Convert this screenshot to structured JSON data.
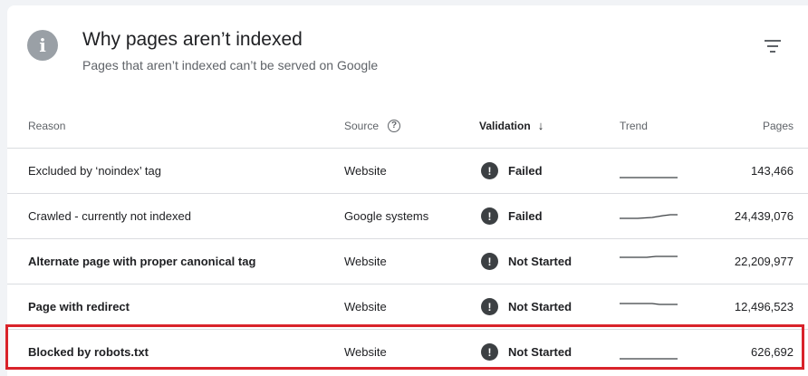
{
  "header": {
    "title": "Why pages aren’t indexed",
    "subtitle": "Pages that aren’t indexed can’t be served on Google"
  },
  "columns": {
    "reason": "Reason",
    "source": "Source",
    "validation": "Validation",
    "trend": "Trend",
    "pages": "Pages"
  },
  "rows": [
    {
      "reason": "Excluded by ‘noindex’ tag",
      "source": "Website",
      "validation": "Failed",
      "pages": "143,466"
    },
    {
      "reason": "Crawled - currently not indexed",
      "source": "Google systems",
      "validation": "Failed",
      "pages": "24,439,076"
    },
    {
      "reason": "Alternate page with proper canonical tag",
      "source": "Website",
      "validation": "Not Started",
      "pages": "22,209,977"
    },
    {
      "reason": "Page with redirect",
      "source": "Website",
      "validation": "Not Started",
      "pages": "12,496,523"
    },
    {
      "reason": "Blocked by robots.txt",
      "source": "Website",
      "validation": "Not Started",
      "pages": "626,692"
    }
  ],
  "colors": {
    "highlight": "#d9232a",
    "status_icon": "#3c4043"
  }
}
